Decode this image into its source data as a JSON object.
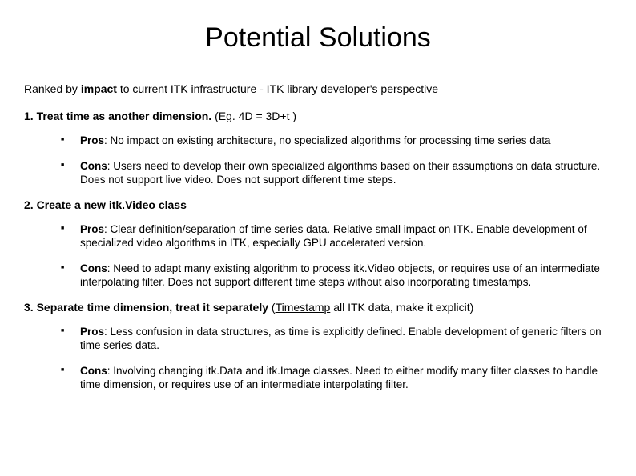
{
  "title": "Potential Solutions",
  "subtitle_pre": "Ranked by ",
  "subtitle_b": "impact",
  "subtitle_post": " to current ITK infrastructure - ITK library developer's perspective",
  "s1": {
    "num": "1. ",
    "head": "Treat time as another dimension. ",
    "tail": "(Eg. 4D = 3D+t )",
    "pros_label": "Pros",
    "pros": ": No impact on existing architecture, no specialized algorithms for processing time series data",
    "cons_label": "Cons",
    "cons": ": Users need to develop their own specialized algorithms based on their assumptions on data structure.  Does not support live video.  Does not support different time steps."
  },
  "s2": {
    "num": "2. ",
    "head_pre": "Create a new ",
    "head_b": "itk.Video",
    "head_post": " class",
    "pros_label": "Pros",
    "pros": ": Clear definition/separation of time series data. Relative small impact on ITK. Enable development of specialized video algorithms in ITK, especially GPU accelerated version.",
    "cons_label": "Cons",
    "cons": ": Need to adapt many existing algorithm to process itk.Video objects, or requires use of an intermediate interpolating filter.  Does not support different time steps without also incorporating timestamps."
  },
  "s3": {
    "num": "3. ",
    "head": "Separate time dimension, treat it separately ",
    "tail_pre": "(",
    "tail_u": "Timestamp",
    "tail_post": " all ITK data, make it explicit)",
    "pros_label": "Pros",
    "pros": ": Less confusion in data structures, as time is explicitly defined. Enable development of generic filters on time series data.",
    "cons_label": "Cons",
    "cons": ": Involving changing itk.Data and itk.Image classes.  Need to either modify many filter classes to handle time dimension, or requires use of an intermediate interpolating filter."
  }
}
